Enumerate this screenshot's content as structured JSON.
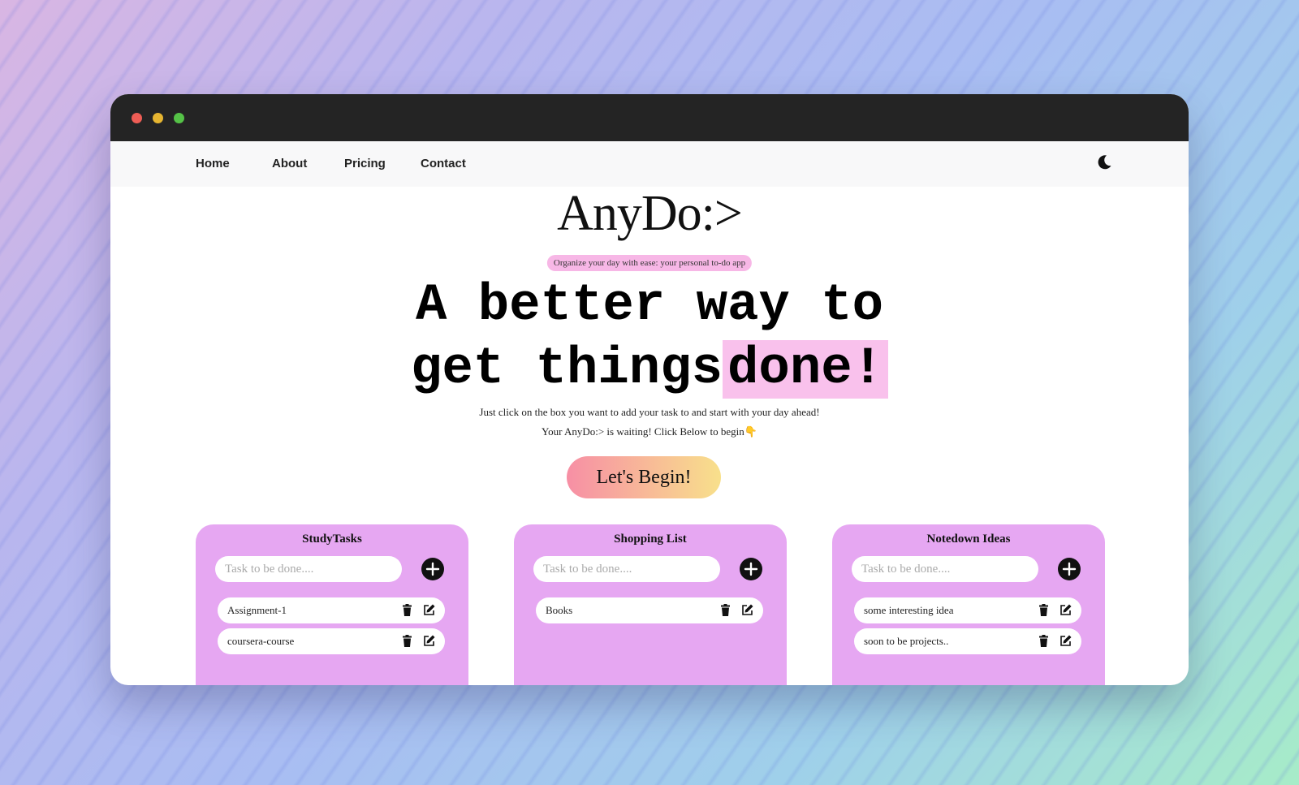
{
  "nav": {
    "links": [
      "Home",
      "About",
      "Pricing",
      "Contact"
    ]
  },
  "icons": {
    "theme": "moon-icon",
    "add": "plus-circle-icon",
    "delete": "trash-icon",
    "edit": "edit-icon"
  },
  "colors": {
    "card": "#e6a7f2",
    "highlight": "#f9c1ec",
    "tagline_bg": "#f7b7e6",
    "titlebar": "#242424"
  },
  "hero": {
    "brand": "AnyDo:>",
    "tagline": "Organize your day with ease: your personal to-do app",
    "headline_line1": "A better way to",
    "headline_line2_plain": "get things",
    "headline_line2_highlight": "done!",
    "subtext1": "Just click on the box you want to add your task to and start with your day ahead!",
    "subtext2": "Your AnyDo:> is waiting! Click Below to begin👇",
    "cta": "Let's Begin!"
  },
  "cards": [
    {
      "title": "StudyTasks",
      "placeholder": "Task to be done....",
      "tasks": [
        "Assignment-1",
        "coursera-course"
      ]
    },
    {
      "title": "Shopping List",
      "placeholder": "Task to be done....",
      "tasks": [
        "Books"
      ]
    },
    {
      "title": "Notedown Ideas",
      "placeholder": "Task to be done....",
      "tasks": [
        "some interesting idea",
        "soon to be projects.."
      ]
    }
  ]
}
